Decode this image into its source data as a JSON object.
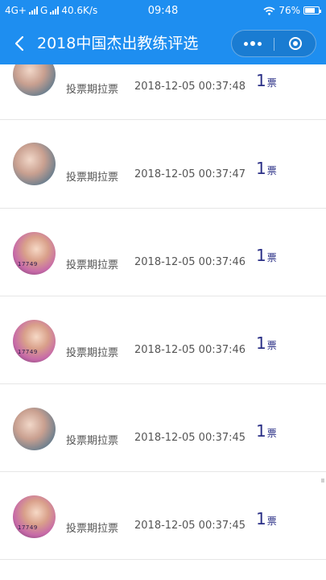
{
  "status_bar": {
    "network_left": "4G+",
    "network_mid": "G",
    "speed": "40.6K/s",
    "time": "09:48",
    "battery_text": "76%",
    "battery_level": 0.76
  },
  "header": {
    "title": "2018中国杰出教练评选"
  },
  "colors": {
    "accent": "#1e8ef0",
    "vote_number": "#2a2f86"
  },
  "records": [
    {
      "label": "投票期拉票",
      "time": "2018-12-05 00:37:48",
      "count": "1",
      "unit": "票",
      "avatar_text": ""
    },
    {
      "label": "投票期拉票",
      "time": "2018-12-05 00:37:47",
      "count": "1",
      "unit": "票",
      "avatar_text": ""
    },
    {
      "label": "投票期拉票",
      "time": "2018-12-05 00:37:46",
      "count": "1",
      "unit": "票",
      "avatar_text": "17749"
    },
    {
      "label": "投票期拉票",
      "time": "2018-12-05 00:37:46",
      "count": "1",
      "unit": "票",
      "avatar_text": "17749"
    },
    {
      "label": "投票期拉票",
      "time": "2018-12-05 00:37:45",
      "count": "1",
      "unit": "票",
      "avatar_text": ""
    },
    {
      "label": "投票期拉票",
      "time": "2018-12-05 00:37:45",
      "count": "1",
      "unit": "票",
      "avatar_text": "17749"
    }
  ]
}
